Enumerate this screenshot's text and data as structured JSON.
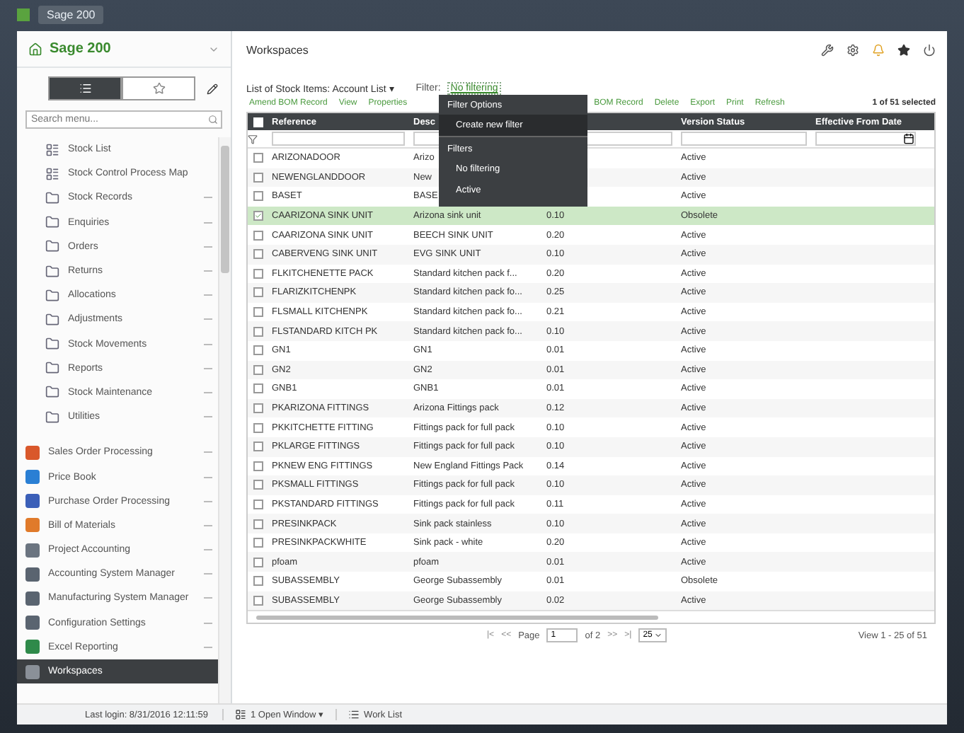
{
  "window": {
    "title": "Sage 200"
  },
  "sidebar": {
    "title": "Sage 200",
    "search": {
      "placeholder": "Search menu..."
    },
    "view_toggle": [
      {
        "kind": "list",
        "selected": true
      },
      {
        "kind": "favourites",
        "selected": false
      }
    ],
    "items": [
      {
        "label": "Stock List",
        "kind": "list"
      },
      {
        "label": "Stock Control Process Map",
        "kind": "list"
      },
      {
        "label": "Stock Records",
        "kind": "folder"
      },
      {
        "label": "Enquiries",
        "kind": "folder"
      },
      {
        "label": "Orders",
        "kind": "folder"
      },
      {
        "label": "Returns",
        "kind": "folder"
      },
      {
        "label": "Allocations",
        "kind": "folder"
      },
      {
        "label": "Adjustments",
        "kind": "folder"
      },
      {
        "label": "Stock Movements",
        "kind": "folder"
      },
      {
        "label": "Reports",
        "kind": "folder"
      },
      {
        "label": "Stock Maintenance",
        "kind": "folder"
      },
      {
        "label": "Utilities",
        "kind": "folder"
      }
    ],
    "modules": [
      {
        "label": "Sales Order Processing",
        "color": "#d9582b",
        "selected": false
      },
      {
        "label": "Price Book",
        "color": "#2a7fd4",
        "selected": false
      },
      {
        "label": "Purchase Order Processing",
        "color": "#3b5fb8",
        "selected": false
      },
      {
        "label": "Bill of Materials",
        "color": "#e07a2a",
        "selected": false
      },
      {
        "label": "Project Accounting",
        "color": "#6b7480",
        "selected": false
      },
      {
        "label": "Accounting System Manager",
        "color": "#5a6470",
        "selected": false
      },
      {
        "label": "Manufacturing System Manager",
        "color": "#5a6470",
        "selected": false
      },
      {
        "label": "Configuration Settings",
        "color": "#5a6470",
        "selected": false
      },
      {
        "label": "Excel Reporting",
        "color": "#2f8a4a",
        "selected": false
      },
      {
        "label": "Workspaces",
        "color": "#8a9098",
        "selected": true
      }
    ]
  },
  "status_bar": {
    "last_login": "Last login: 8/31/2016 12:11:59",
    "open_windows": "1 Open Window ▾",
    "work_list": "Work List"
  },
  "main": {
    "title": "Workspaces",
    "list_title": "List of Stock Items: Account List ▾",
    "filter_label": "Filter:",
    "filter_value": "No filtering",
    "actions": [
      "Amend BOM Record",
      "View",
      "Properties",
      "BOM Record",
      "Delete",
      "Export",
      "Print",
      "Refresh"
    ],
    "selection_count": "1 of 51 selected",
    "filter_menu": {
      "heading": "Filter Options",
      "items": [
        {
          "label": "Create new filter",
          "kind": "action",
          "selected": true
        },
        {
          "label": "Filters",
          "kind": "heading",
          "selected": false
        },
        {
          "label": "No filtering",
          "kind": "option",
          "selected": false
        },
        {
          "label": "Active",
          "kind": "option",
          "selected": false
        }
      ]
    },
    "table": {
      "select_all": {
        "checked": false
      },
      "columns": [
        {
          "kind": "text",
          "label": "Reference"
        },
        {
          "kind": "text",
          "label": "Desc"
        },
        {
          "kind": "covered"
        },
        {
          "kind": "text",
          "label": "Version Status"
        },
        {
          "kind": "text",
          "label": "Effective From Date"
        }
      ],
      "rows": [
        {
          "checked": false,
          "cells": [
            "ARIZONADOOR",
            "Arizo",
            "",
            "Active",
            ""
          ]
        },
        {
          "checked": false,
          "cells": [
            "NEWENGLANDDOOR",
            "New",
            "",
            "Active",
            ""
          ]
        },
        {
          "checked": false,
          "cells": [
            "BASET",
            "BASE",
            "",
            "Active",
            ""
          ]
        },
        {
          "checked": true,
          "cells": [
            "CAARIZONA SINK UNIT",
            "Arizona sink unit",
            "0.10",
            "Obsolete",
            ""
          ]
        },
        {
          "checked": false,
          "cells": [
            "CAARIZONA SINK UNIT",
            "BEECH SINK UNIT",
            "0.20",
            "Active",
            ""
          ]
        },
        {
          "checked": false,
          "cells": [
            "CABERVENG SINK UNIT",
            "EVG SINK UNIT",
            "0.10",
            "Active",
            ""
          ]
        },
        {
          "checked": false,
          "cells": [
            "FLKITCHENETTE PACK",
            "Standard kitchen pack f...",
            "0.20",
            "Active",
            ""
          ]
        },
        {
          "checked": false,
          "cells": [
            "FLARIZKITCHENPK",
            "Standard kitchen pack fo...",
            "0.25",
            "Active",
            ""
          ]
        },
        {
          "checked": false,
          "cells": [
            "FLSMALL KITCHENPK",
            "Standard kitchen pack fo...",
            "0.21",
            "Active",
            ""
          ]
        },
        {
          "checked": false,
          "cells": [
            "FLSTANDARD KITCH PK",
            "Standard kitchen pack fo...",
            "0.10",
            "Active",
            ""
          ]
        },
        {
          "checked": false,
          "cells": [
            "GN1",
            "GN1",
            "0.01",
            "Active",
            ""
          ]
        },
        {
          "checked": false,
          "cells": [
            "GN2",
            "GN2",
            "0.01",
            "Active",
            ""
          ]
        },
        {
          "checked": false,
          "cells": [
            "GNB1",
            "GNB1",
            "0.01",
            "Active",
            ""
          ]
        },
        {
          "checked": false,
          "cells": [
            "PKARIZONA FITTINGS",
            "Arizona Fittings pack",
            "0.12",
            "Active",
            ""
          ]
        },
        {
          "checked": false,
          "cells": [
            "PKKITCHETTE FITTING",
            "Fittings pack for full pack",
            "0.10",
            "Active",
            ""
          ]
        },
        {
          "checked": false,
          "cells": [
            "PKLARGE FITTINGS",
            "Fittings pack for full pack",
            "0.10",
            "Active",
            ""
          ]
        },
        {
          "checked": false,
          "cells": [
            "PKNEW ENG FITTINGS",
            "New England Fittings Pack",
            "0.14",
            "Active",
            ""
          ]
        },
        {
          "checked": false,
          "cells": [
            "PKSMALL FITTINGS",
            "Fittings pack for full pack",
            "0.10",
            "Active",
            ""
          ]
        },
        {
          "checked": false,
          "cells": [
            "PKSTANDARD FITTINGS",
            "Fittings pack for full pack",
            "0.11",
            "Active",
            ""
          ]
        },
        {
          "checked": false,
          "cells": [
            "PRESINKPACK",
            "Sink pack stainless",
            "0.10",
            "Active",
            ""
          ]
        },
        {
          "checked": false,
          "cells": [
            "PRESINKPACKWHITE",
            "Sink pack - white",
            "0.20",
            "Active",
            ""
          ]
        },
        {
          "checked": false,
          "cells": [
            "pfoam",
            "pfoam",
            "0.01",
            "Active",
            ""
          ]
        },
        {
          "checked": false,
          "cells": [
            "SUBASSEMBLY",
            "George Subassembly",
            "0.01",
            "Obsolete",
            ""
          ]
        },
        {
          "checked": false,
          "cells": [
            "SUBASSEMBLY",
            "George Subassembly",
            "0.02",
            "Active",
            ""
          ]
        }
      ]
    },
    "pager": {
      "page_label": "Page",
      "page": "1",
      "of": "of 2",
      "first": "|<",
      "prev": "<<",
      "next": ">>",
      "last": ">|",
      "page_size": "25",
      "view": "View 1 - 25 of 51"
    }
  }
}
